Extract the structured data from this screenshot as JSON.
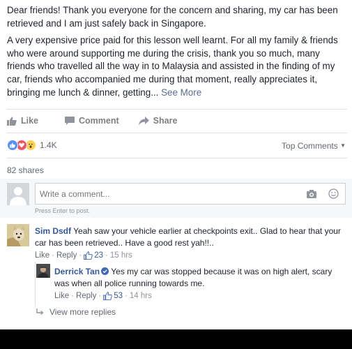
{
  "post": {
    "para1": "Dear friends! Thank you everyone for the concern and sharing, my car has been retrieved and I am just safely back in Singapore.",
    "para2": "A very expensive price paid for this lesson well learnt. For all my family & friends who were around supporting me during the crisis, thank you so much, many friends who travelled all the way in to Malaysia and assisted in the finding of my car, friends who accompanied me during that moment, really appreciates it, bringing me lunch & dinner, getting...",
    "see_more": "See More"
  },
  "actions": {
    "like": "Like",
    "comment": "Comment",
    "share": "Share"
  },
  "reactions": {
    "count": "1.4K",
    "top_comments": "Top Comments",
    "shares": "82 shares"
  },
  "comment_box": {
    "placeholder": "Write a comment...",
    "hint": "Press Enter to post."
  },
  "comments": [
    {
      "name": "Sim Dsdf",
      "text": "Yeah saw your vehicle earlier at checkpoints exit.. Glad to hear that your car has been retrieved.. Have a good rest yah!!..",
      "like": "Like",
      "reply": "Reply",
      "likes": "23",
      "time": "15 hrs"
    }
  ],
  "reply": {
    "name": "Derrick Tan",
    "text": "Yes my car was stopped because it was on high alert, scary was when all police running towards me.",
    "like": "Like",
    "reply": "Reply",
    "likes": "53",
    "time": "14 hrs"
  },
  "view_more_replies": "View more replies",
  "colors": {
    "link": "#365899",
    "like_blue": "#5890ff",
    "love_red": "#f25268",
    "wow_yellow": "#fcd15a"
  }
}
